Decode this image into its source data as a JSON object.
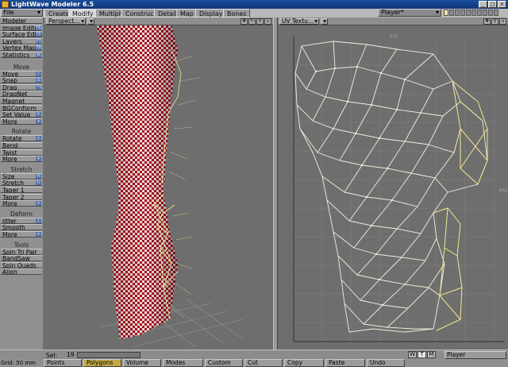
{
  "window": {
    "title": "LightWave Modeler 6.5"
  },
  "menu": {
    "file": "File"
  },
  "tabs": [
    "Create",
    "Modify",
    "Multiply",
    "Construct",
    "Detail",
    "Map",
    "Display",
    "Bones"
  ],
  "active_tab": "Modify",
  "layer_select": {
    "value": "Player*"
  },
  "sidebar": {
    "top_items": [
      {
        "label": "Modeler",
        "key": ""
      },
      {
        "label": "Image Editor",
        "key": "F6"
      },
      {
        "label": "Surface Editor",
        "key": "F5"
      },
      {
        "label": "Layers",
        "key": "F7"
      },
      {
        "label": "Vertex Maps",
        "key": "F8"
      },
      {
        "label": "Statistics",
        "key": "W"
      }
    ],
    "sections": [
      {
        "title": "Move",
        "items": [
          {
            "label": "Move",
            "key": "t"
          },
          {
            "label": "Snap",
            "key": "G"
          },
          {
            "label": "Drag",
            "key": "^t"
          },
          {
            "label": "DragNet",
            "key": ""
          },
          {
            "label": "Magnet",
            "key": ""
          },
          {
            "label": "BGConform",
            "key": ""
          },
          {
            "label": "Set Value",
            "key": "V"
          },
          {
            "label": "More",
            "key": "▾"
          }
        ]
      },
      {
        "title": "Rotate",
        "items": [
          {
            "label": "Rotate",
            "key": "y"
          },
          {
            "label": "Bend",
            "key": ""
          },
          {
            "label": "Twist",
            "key": ""
          },
          {
            "label": "More",
            "key": "▾"
          }
        ]
      },
      {
        "title": "Stretch",
        "items": [
          {
            "label": "Size",
            "key": "H"
          },
          {
            "label": "Stretch",
            "key": "h"
          },
          {
            "label": "Taper 1",
            "key": ""
          },
          {
            "label": "Taper 2",
            "key": ""
          },
          {
            "label": "More",
            "key": "▾"
          }
        ]
      },
      {
        "title": "Deform",
        "items": [
          {
            "label": "Jitter",
            "key": "J"
          },
          {
            "label": "Smooth",
            "key": ""
          },
          {
            "label": "More",
            "key": "▾"
          }
        ]
      },
      {
        "title": "Tools",
        "items": [
          {
            "label": "Spin Tri Pair",
            "key": ""
          },
          {
            "label": "BandSaw",
            "key": ""
          },
          {
            "label": "Spin Quads",
            "key": ""
          },
          {
            "label": "Align",
            "key": ""
          }
        ]
      }
    ]
  },
  "viewports": {
    "left": {
      "mode": "Perspect..."
    },
    "right": {
      "mode": "UV Textu...",
      "axis_top": "+V",
      "axis_right": "+U"
    }
  },
  "status": {
    "sel_label": "Sel:",
    "sel_value": "19",
    "wtm": [
      "W",
      "T",
      "M"
    ],
    "wtm_active": "T",
    "player": "Player"
  },
  "bottombar": {
    "grid_label": "Grid:",
    "grid_value": "50 mm",
    "buttons": [
      "Points",
      "Polygons",
      "Volume",
      "Modes",
      "Custom",
      "Cut",
      "Copy",
      "Paste",
      "Undo"
    ],
    "active": "Polygons"
  },
  "colors": {
    "title_bg": "#10377a",
    "checker_red": "#b0101e",
    "uv_line": "#fff7cc",
    "selection_yellow": "#f3e88e"
  }
}
